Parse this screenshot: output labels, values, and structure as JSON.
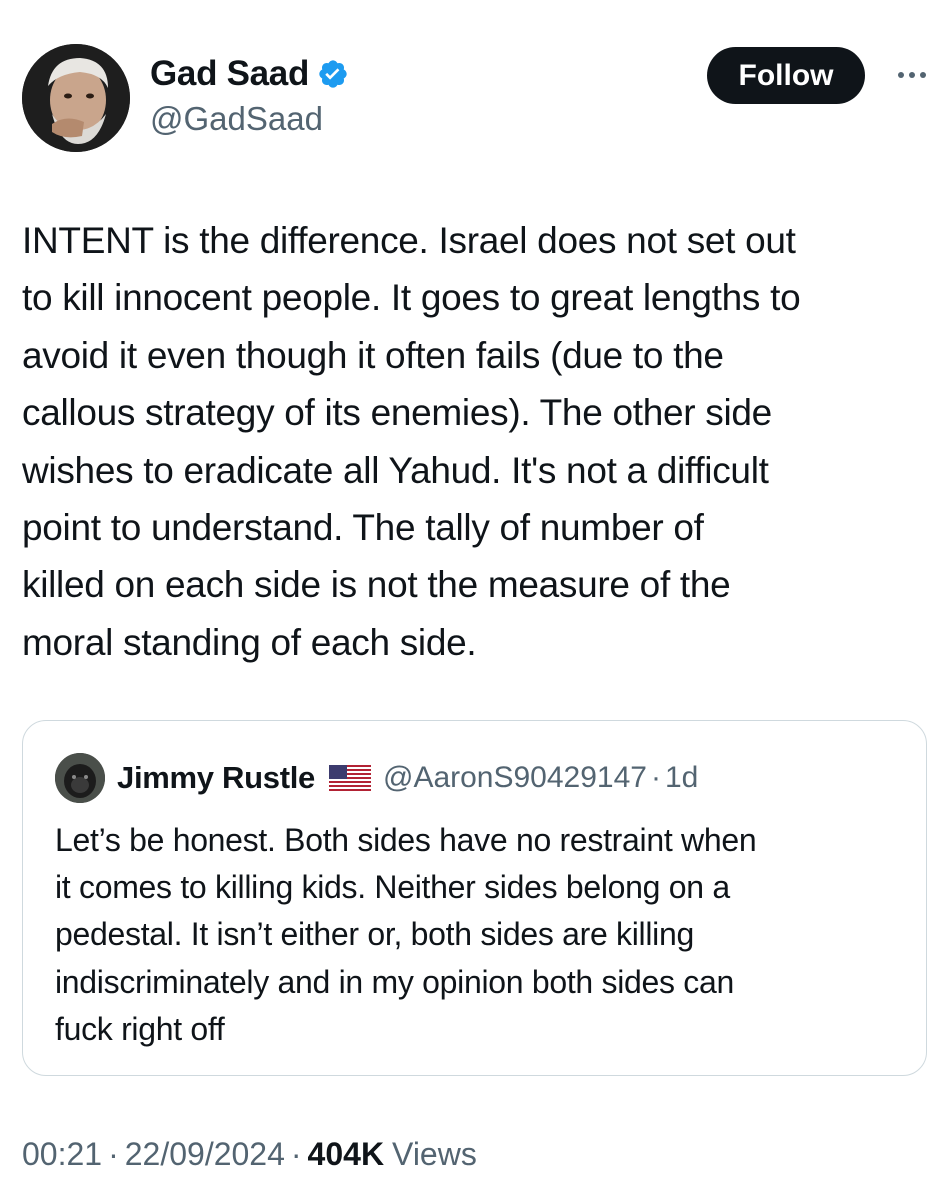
{
  "author": {
    "name": "Gad Saad",
    "handle": "@GadSaad",
    "verified": true,
    "verified_color": "#1d9bf0"
  },
  "actions": {
    "follow_label": "Follow"
  },
  "tweet": {
    "lines": [
      "INTENT is the difference.  Israel does not set out",
      "to kill innocent people.  It goes to great lengths to",
      "avoid it even though it often fails (due to the",
      "callous strategy of its enemies).  The other side",
      "wishes to eradicate all Yahud.  It's not a difficult",
      "point to understand.  The tally of number of",
      "killed on each side is not the measure of the",
      "moral standing of each side."
    ]
  },
  "quoted_tweet": {
    "name": "Jimmy Rustle",
    "flag_icon": "us-flag-icon",
    "handle": "@AaronS90429147",
    "separator": "·",
    "time": "1d",
    "lines": [
      "Let’s be honest. Both sides have no restraint when",
      "it comes to killing kids. Neither sides belong on a",
      "pedestal. It isn’t either or, both sides are killing",
      "indiscriminately and in my opinion both sides can",
      "fuck right off"
    ]
  },
  "meta": {
    "time": "00:21",
    "separator": "·",
    "date": "22/09/2024",
    "views_count": "404K",
    "views_label": "Views"
  },
  "colors": {
    "text": "#0f1419",
    "secondary": "#536471",
    "border": "#cfd9de",
    "button_bg": "#0f1419"
  }
}
